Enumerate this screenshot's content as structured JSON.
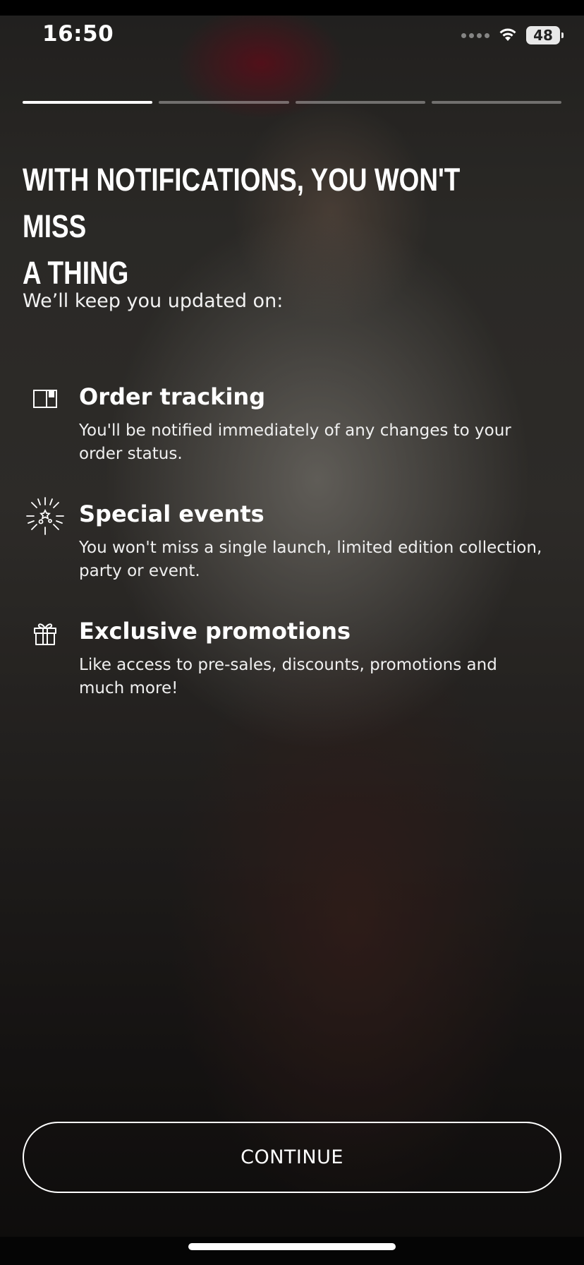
{
  "status_bar": {
    "time": "16:50",
    "battery": "48"
  },
  "onboarding": {
    "step_count": 4,
    "active_step": 1,
    "title_line1": "WITH NOTIFICATIONS, YOU WON'T MISS",
    "title_line2": "A THING",
    "subtitle": "We’ll keep you updated on:",
    "features": [
      {
        "icon": "package-box-icon",
        "title": "Order tracking",
        "description": "You'll be notified immediately of any changes to your order status."
      },
      {
        "icon": "sparkle-burst-icon",
        "title": "Special events",
        "description": "You won't miss a single launch, limited edition collection, party or event."
      },
      {
        "icon": "gift-icon",
        "title": "Exclusive promotions",
        "description": "Like access to pre-sales, discounts, promotions and much more!"
      }
    ],
    "continue_label": "CONTINUE"
  },
  "colors": {
    "text": "#ffffff",
    "progress_active": "#ffffff",
    "progress_inactive": "rgba(255,255,255,0.35)"
  }
}
